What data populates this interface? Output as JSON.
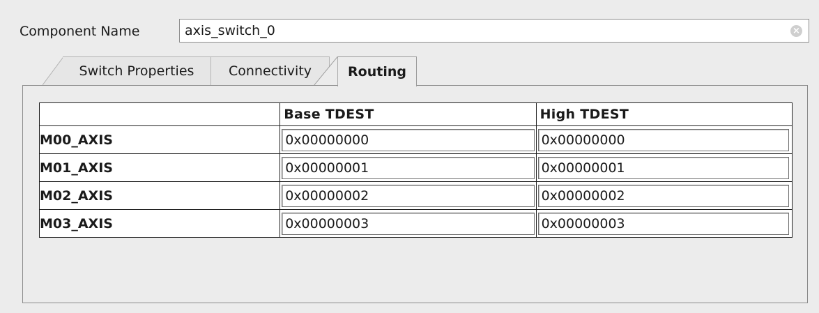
{
  "component": {
    "label": "Component Name",
    "value": "axis_switch_0"
  },
  "tabs": [
    {
      "label": "Switch Properties",
      "active": false
    },
    {
      "label": "Connectivity",
      "active": false
    },
    {
      "label": "Routing",
      "active": true
    }
  ],
  "routing_table": {
    "headers": [
      "",
      "Base TDEST",
      "High TDEST"
    ],
    "rows": [
      {
        "name": "M00_AXIS",
        "base": "0x00000000",
        "high": "0x00000000"
      },
      {
        "name": "M01_AXIS",
        "base": "0x00000001",
        "high": "0x00000001"
      },
      {
        "name": "M02_AXIS",
        "base": "0x00000002",
        "high": "0x00000002"
      },
      {
        "name": "M03_AXIS",
        "base": "0x00000003",
        "high": "0x00000003"
      }
    ]
  },
  "icons": {
    "clear": "clear-icon"
  }
}
